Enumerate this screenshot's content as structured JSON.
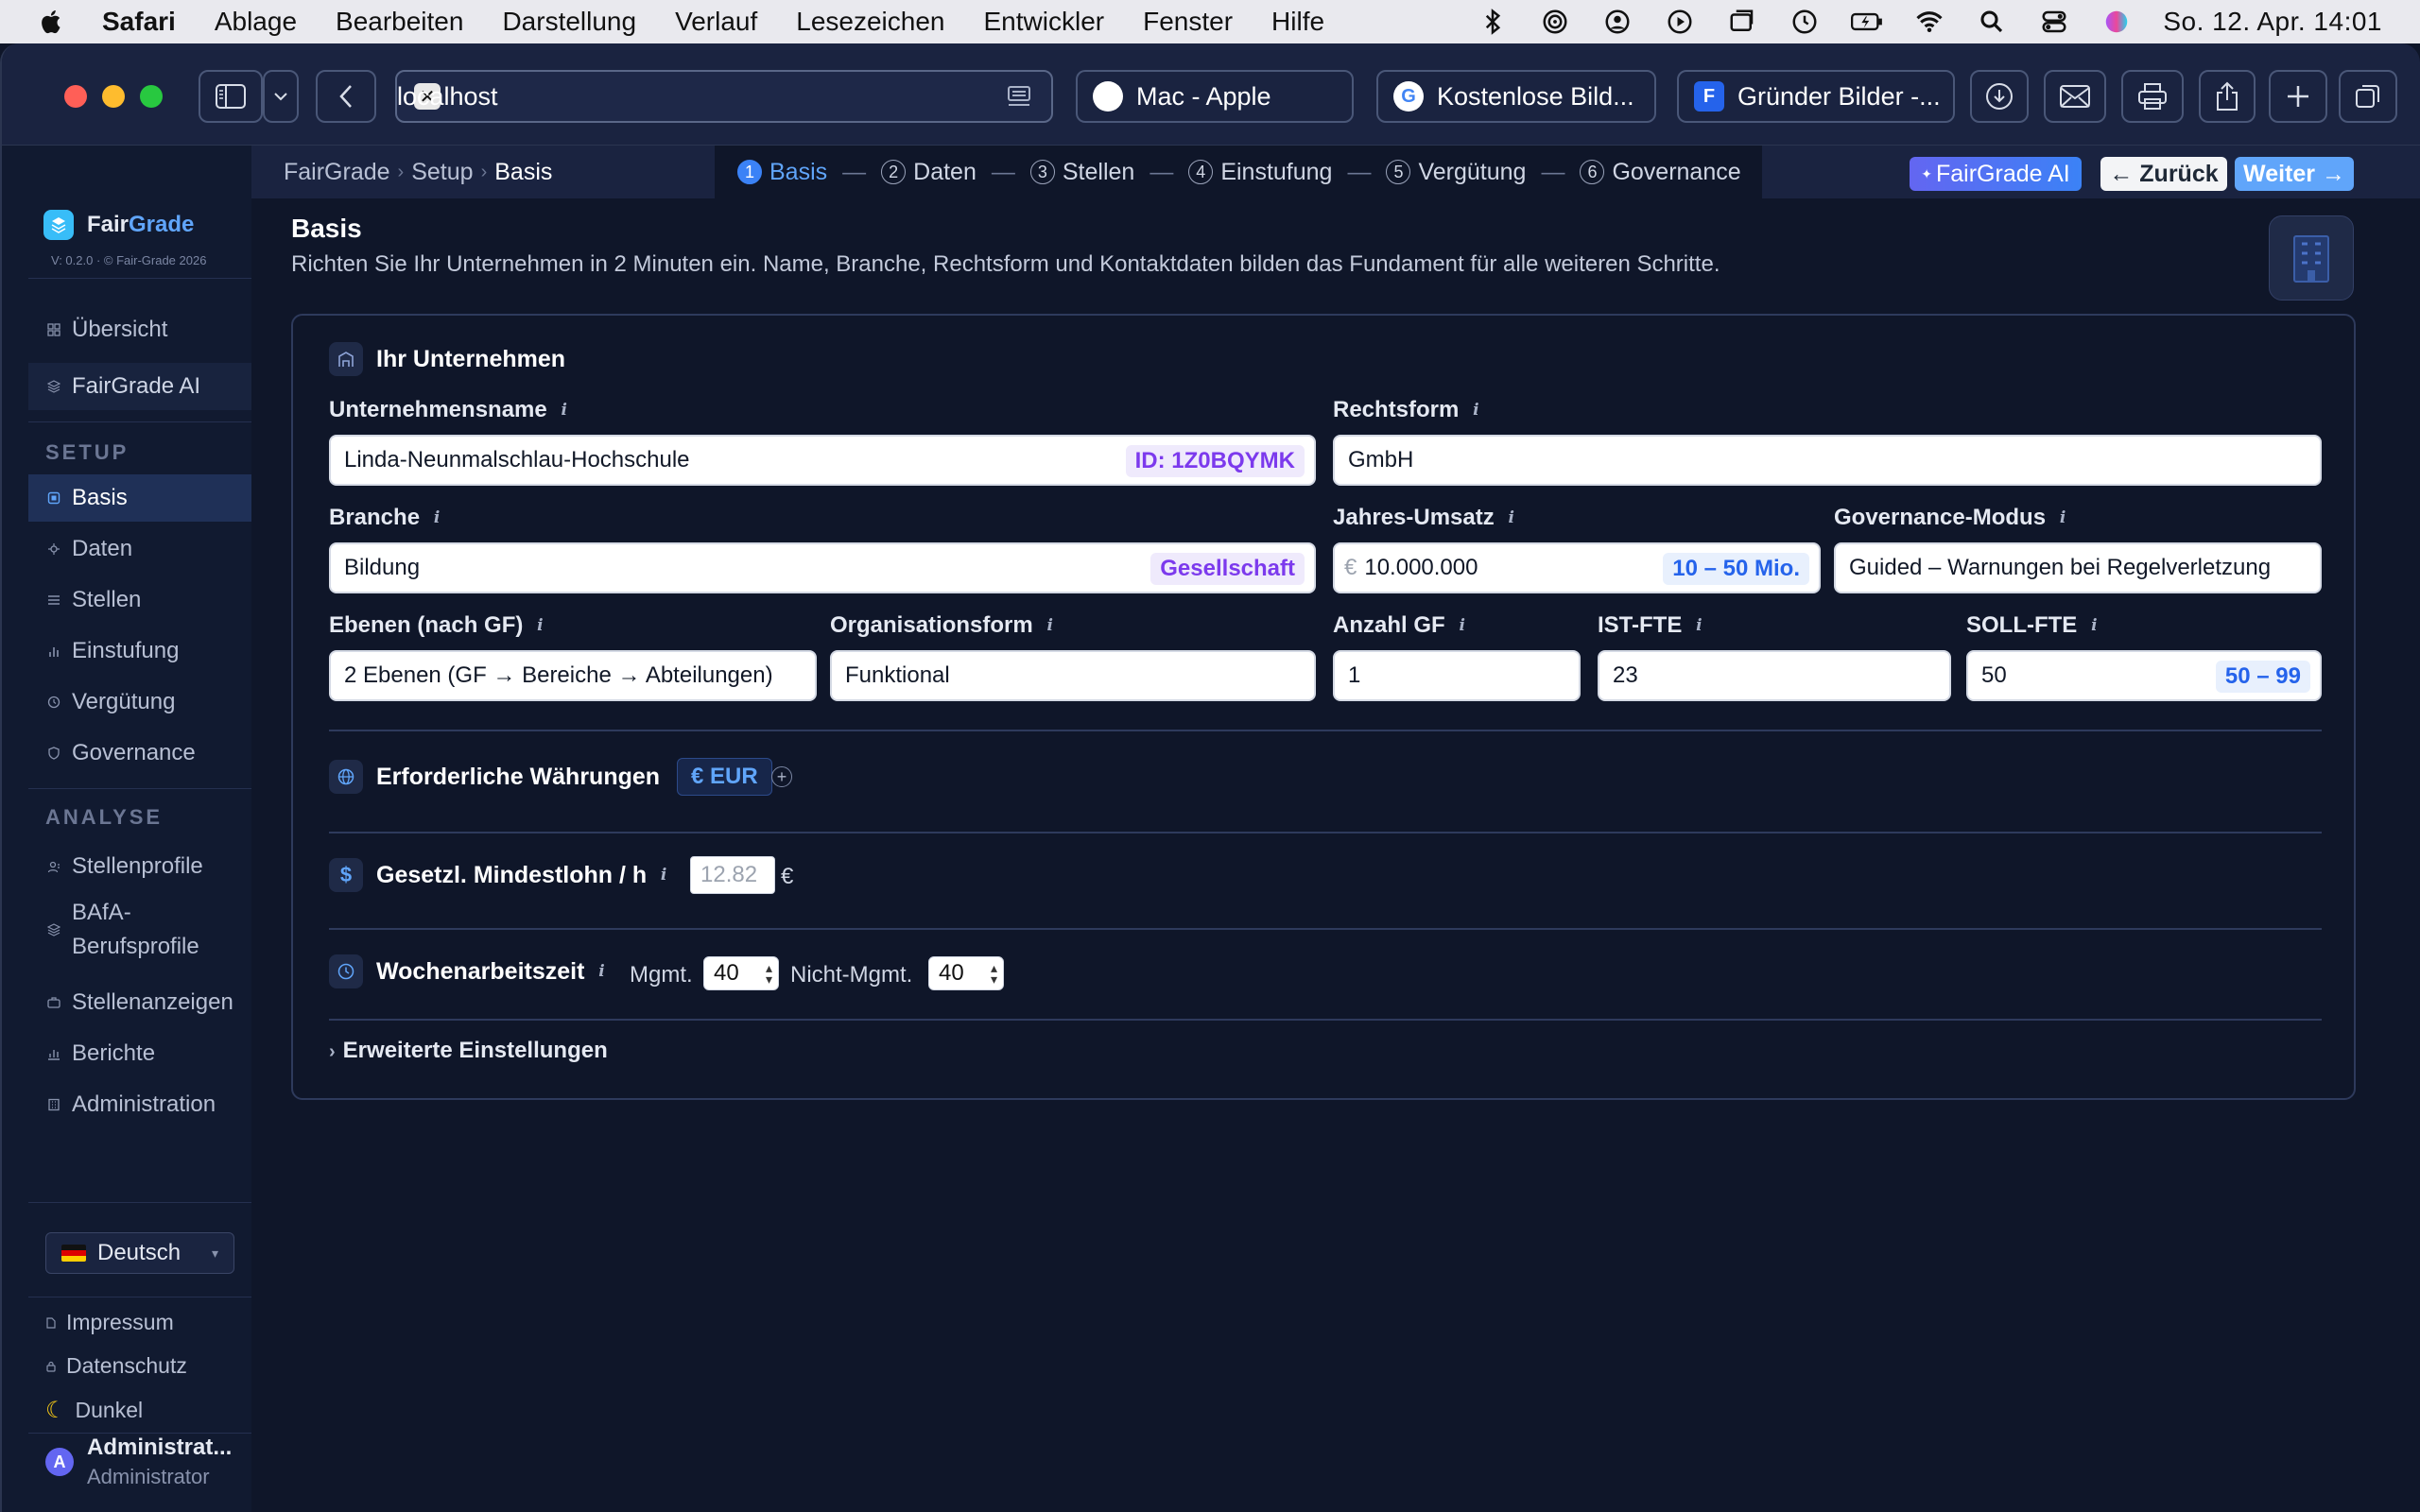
{
  "menubar": {
    "app": "Safari",
    "items": [
      "Ablage",
      "Bearbeiten",
      "Darstellung",
      "Verlauf",
      "Lesezeichen",
      "Entwickler",
      "Fenster",
      "Hilfe"
    ],
    "clock": "So. 12. Apr.  14:01"
  },
  "browser": {
    "url": "localhost",
    "tabs": [
      {
        "label": "Mac - Apple",
        "icon": "apple-icon"
      },
      {
        "label": "Kostenlose Bild...",
        "icon": "google-icon"
      },
      {
        "label": "Gründer Bilder -...",
        "icon": "page-icon"
      }
    ]
  },
  "brand": {
    "name_a": "Fair",
    "name_b": "Grade",
    "version": "V: 0.2.0 · © Fair-Grade 2026"
  },
  "sidebar": {
    "top": [
      {
        "label": "Übersicht",
        "icon": "grid-icon"
      },
      {
        "label": "FairGrade AI",
        "icon": "layers-icon"
      }
    ],
    "setup_label": "SETUP",
    "setup": [
      {
        "label": "Basis",
        "icon": "square-icon"
      },
      {
        "label": "Daten",
        "icon": "node-icon"
      },
      {
        "label": "Stellen",
        "icon": "list-icon"
      },
      {
        "label": "Einstufung",
        "icon": "bars-icon"
      },
      {
        "label": "Vergütung",
        "icon": "clock-icon"
      },
      {
        "label": "Governance",
        "icon": "shield-icon"
      }
    ],
    "analyse_label": "ANALYSE",
    "analyse": [
      {
        "label": "Stellenprofile",
        "icon": "user-icon"
      },
      {
        "label": "BAfA-",
        "label2": "Berufsprofile",
        "icon": "layers-icon"
      },
      {
        "label": "Stellenanzeigen",
        "icon": "briefcase-icon"
      },
      {
        "label": "Berichte",
        "icon": "chart-icon"
      },
      {
        "label": "Administration",
        "icon": "building-icon"
      }
    ],
    "language": "Deutsch",
    "footer": [
      {
        "label": "Impressum",
        "icon": "doc-icon"
      },
      {
        "label": "Datenschutz",
        "icon": "lock-icon"
      },
      {
        "label": "Dunkel",
        "icon": "moon-icon"
      }
    ],
    "user": {
      "avatar": "A",
      "name": "Administrat...",
      "role": "Administrator"
    }
  },
  "header": {
    "crumbs": [
      "FairGrade",
      "Setup",
      "Basis"
    ],
    "steps": [
      {
        "num": "1",
        "label": "Basis"
      },
      {
        "num": "2",
        "label": "Daten"
      },
      {
        "num": "3",
        "label": "Stellen"
      },
      {
        "num": "4",
        "label": "Einstufung"
      },
      {
        "num": "5",
        "label": "Vergütung"
      },
      {
        "num": "6",
        "label": "Governance"
      }
    ],
    "ai_button": "FairGrade AI",
    "back_button": "← Zurück",
    "next_button": "Weiter →"
  },
  "page": {
    "title": "Basis",
    "subtitle": "Richten Sie Ihr Unternehmen in 2 Minuten ein. Name, Branche, Rechtsform und Kontaktdaten bilden das Fundament für alle weiteren Schritte."
  },
  "form": {
    "section": "Ihr Unternehmen",
    "name_label": "Unternehmensname",
    "name_value": "Linda-Neunmalschlau-Hochschule",
    "name_badge": "ID: 1Z0BQYMK",
    "legal_label": "Rechtsform",
    "legal_value": "GmbH",
    "industry_label": "Branche",
    "industry_value": "Bildung",
    "industry_badge": "Gesellschaft",
    "revenue_label": "Jahres-Umsatz",
    "revenue_prefix": "€",
    "revenue_value": "10.000.000",
    "revenue_badge": "10 – 50 Mio.",
    "gov_label": "Governance-Modus",
    "gov_value": "Guided – Warnungen bei Regelverletzung",
    "levels_label": "Ebenen (nach GF)",
    "levels_value": "2 Ebenen (GF → Bereiche → Abteilungen)",
    "org_label": "Organisationsform",
    "org_value": "Funktional",
    "gf_label": "Anzahl GF",
    "gf_value": "1",
    "ist_label": "IST-FTE",
    "ist_value": "23",
    "soll_label": "SOLL-FTE",
    "soll_value": "50",
    "soll_badge": "50 – 99"
  },
  "currency": {
    "label": "Erforderliche Währungen",
    "chip": "€ EUR",
    "add": "+"
  },
  "wage": {
    "label": "Gesetzl. Mindestlohn / h",
    "placeholder": "12.82",
    "unit": "€"
  },
  "hours": {
    "label": "Wochenarbeitszeit",
    "mgmt_label": "Mgmt.",
    "mgmt_value": "40",
    "non_label": "Nicht-Mgmt.",
    "non_value": "40"
  },
  "advanced": {
    "label": "Erweiterte Einstellungen"
  },
  "colors": {
    "accent": "#3b82f6",
    "bg": "#0f1629",
    "sidebar": "#111a30"
  }
}
